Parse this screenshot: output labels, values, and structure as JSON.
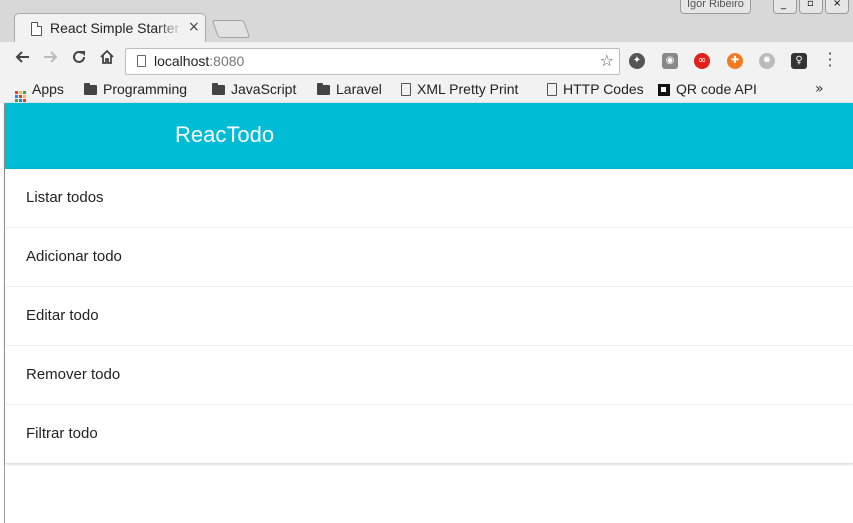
{
  "window": {
    "profile_name": "Igor Ribeiro",
    "tab_title": "React Simple Starter",
    "tab_close": "×"
  },
  "toolbar": {
    "back_icon": "arrow-left-icon",
    "forward_icon": "arrow-right-icon",
    "reload_icon": "reload-icon",
    "home_icon": "home-icon",
    "url_host": "localhost",
    "url_port": ":8080",
    "bookmark_star_icon": "star-icon",
    "extensions": [
      {
        "name": "film-extension-icon",
        "color": "#555555"
      },
      {
        "name": "camera-extension-icon",
        "color": "#777777"
      },
      {
        "name": "adobe-extension-icon",
        "color": "#e0201b"
      },
      {
        "name": "orange-extension-icon",
        "color": "#f47a20"
      },
      {
        "name": "bug-extension-icon",
        "color": "#999999"
      },
      {
        "name": "bulb-extension-icon",
        "color": "#333333"
      }
    ]
  },
  "bookmarks": {
    "items": [
      {
        "label": "Apps",
        "icon": "apps-grid-icon"
      },
      {
        "label": "Programming",
        "icon": "folder-icon"
      },
      {
        "label": "JavaScript",
        "icon": "folder-icon"
      },
      {
        "label": "Laravel",
        "icon": "folder-icon"
      },
      {
        "label": "XML Pretty Print",
        "icon": "page-icon"
      },
      {
        "label": "HTTP Codes",
        "icon": "page-icon"
      },
      {
        "label": "QR code API",
        "icon": "qr-icon"
      }
    ],
    "overflow": "»"
  },
  "app": {
    "title": "ReacTodo",
    "accent_color": "#00bcd4",
    "menu": [
      {
        "label": "Listar todos"
      },
      {
        "label": "Adicionar todo"
      },
      {
        "label": "Editar todo"
      },
      {
        "label": "Remover todo"
      },
      {
        "label": "Filtrar todo"
      }
    ]
  }
}
